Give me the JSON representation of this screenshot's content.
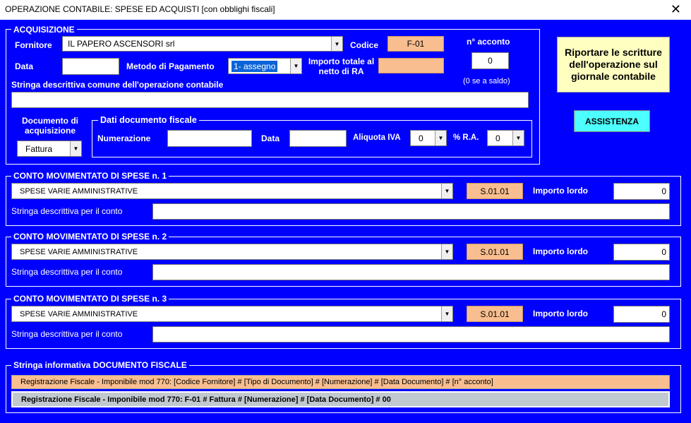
{
  "window": {
    "title": "OPERAZIONE CONTABILE: SPESE ED ACQUISTI [con obblighi fiscali]",
    "close_glyph": "✕"
  },
  "acquisizione": {
    "legend": "ACQUISIZIONE",
    "fornitore_label": "Fornitore",
    "fornitore_value": "IL PAPERO ASCENSORI srl",
    "codice_label": "Codice",
    "codice_value": "F-01",
    "acconto_label": "n° acconto",
    "acconto_value": "0",
    "acconto_hint": "(0 se a saldo)",
    "data_label": "Data",
    "data_value": "",
    "metodo_label": "Metodo di Pagamento",
    "metodo_value": "1- assegno",
    "importo_totale_label": "Importo totale al netto di RA",
    "importo_totale_value": "",
    "stringa_label": "Stringa descrittiva comune dell'operazione contabile",
    "stringa_value": "",
    "documento_label": "Documento di acquisizione",
    "documento_value": "Fattura"
  },
  "dati_documento": {
    "legend": "Dati documento fiscale",
    "numerazione_label": "Numerazione",
    "numerazione_value": "",
    "data_label": "Data",
    "data_value": "",
    "aliquota_label": "Aliquota IVA",
    "aliquota_value": "0",
    "ra_label": "% R.A.",
    "ra_value": "0"
  },
  "buttons": {
    "riportare": "Riportare le scritture dell'operazione sul giornale contabile",
    "assistenza": "ASSISTENZA"
  },
  "conti": [
    {
      "legend": "CONTO MOVIMENTATO DI SPESE n. 1",
      "account": "SPESE VARIE AMMINISTRATIVE",
      "code": "S.01.01",
      "importo_label": "Importo lordo",
      "importo_value": "0",
      "stringa_label": "Stringa descrittiva per il conto",
      "stringa_value": ""
    },
    {
      "legend": "CONTO MOVIMENTATO DI SPESE n. 2",
      "account": "SPESE VARIE AMMINISTRATIVE",
      "code": "S.01.01",
      "importo_label": "Importo lordo",
      "importo_value": "0",
      "stringa_label": "Stringa descrittiva per il conto",
      "stringa_value": ""
    },
    {
      "legend": "CONTO MOVIMENTATO DI SPESE n. 3",
      "account": "SPESE VARIE AMMINISTRATIVE",
      "code": "S.01.01",
      "importo_label": "Importo lordo",
      "importo_value": "0",
      "stringa_label": "Stringa descrittiva per il conto",
      "stringa_value": ""
    }
  ],
  "stringa_info": {
    "legend": "Stringa informativa DOCUMENTO FISCALE",
    "template": "Registrazione Fiscale - Imponibile mod 770: [Codice Fornitore] # [Tipo di Documento] # [Numerazione] # [Data Documento] # [n° acconto]",
    "result": "Registrazione Fiscale - Imponibile mod 770: F-01 # Fattura # [Numerazione] # [Data Documento] # 00"
  },
  "colors": {
    "background": "#0000ff",
    "code_field": "#f9be8f",
    "big_button": "#ffffc0",
    "assist_button": "#4dffff",
    "result_bar": "#c0c8d0"
  },
  "icons": {
    "dropdown_arrow": "chevron-down-icon",
    "close": "close-icon"
  }
}
